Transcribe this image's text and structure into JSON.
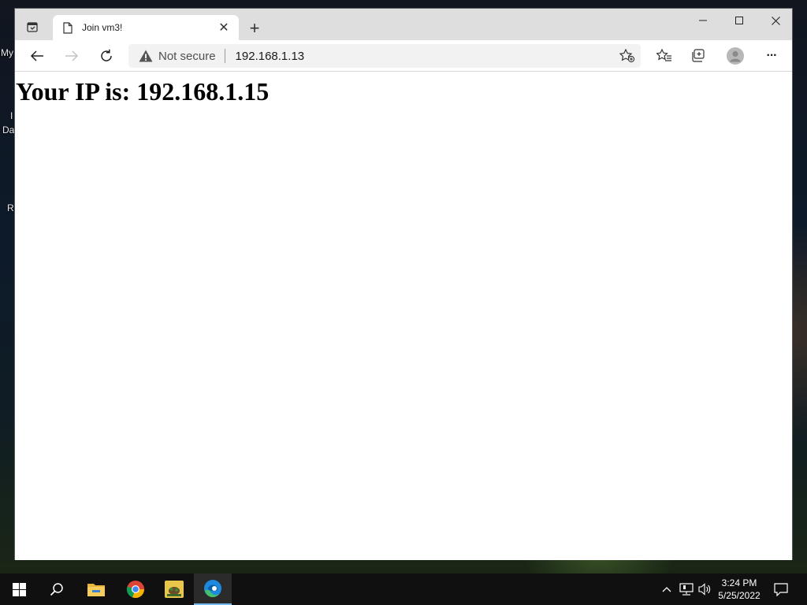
{
  "desktop": {
    "labels": [
      "My",
      "I",
      "Da",
      "R"
    ]
  },
  "browser": {
    "tab": {
      "title": "Join vm3!",
      "close": "✕"
    },
    "new_tab": "+",
    "address_bar": {
      "security": "Not secure",
      "url": "192.168.1.13"
    },
    "more_menu": "···"
  },
  "page": {
    "heading": "Your IP is: 192.168.1.15"
  },
  "taskbar": {
    "pinned": [
      "start-icon",
      "search-icon",
      "file-explorer-icon",
      "chrome-icon",
      "app-icon",
      "edge-icon"
    ],
    "clock": {
      "time": "3:24 PM",
      "date": "5/25/2022"
    }
  },
  "colors": {
    "taskbar_bg": "#101010",
    "titlebar_bg": "#dedede",
    "active_indicator": "#76b9ed"
  }
}
